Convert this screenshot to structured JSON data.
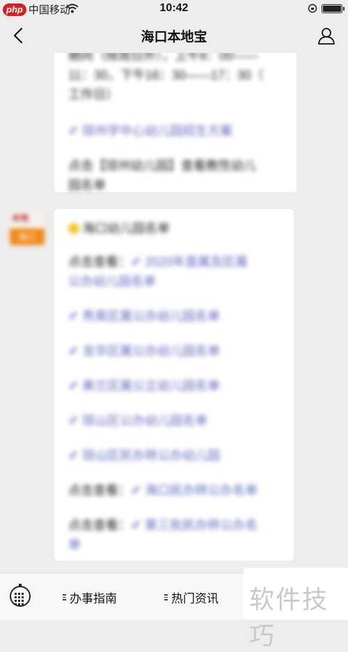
{
  "status_bar": {
    "badge": "php",
    "carrier": "中国移动",
    "time": "10:42"
  },
  "nav": {
    "title": "海口本地宝"
  },
  "message1": {
    "line1": "期间（除周日外），上午8：00——",
    "line2": "11：30，下午16：30——17：30（",
    "line3": "工作日）",
    "link": "✐ 琼州学中心幼儿园招生方案",
    "bottom_l1": "点击【琼州幼儿园】查看教性幼儿",
    "bottom_l2": "园名单"
  },
  "sender": {
    "avatar_top": "本地",
    "avatar_bottom": "海口"
  },
  "message2": {
    "heading": "海口幼儿园名单",
    "prefix1": "点击查看：",
    "link1_l1": "✐ 2020年直属及区属",
    "link1_l2": "公办幼儿园名单",
    "links": [
      "✐ 秀英区属公办幼儿园名单",
      "✐ 龙华区属公办幼儿园名单",
      "✐ 美兰区属公立幼儿园名单",
      "✐ 琼山区公办幼儿园名单",
      "✐ 琼山区民办转公办幼儿园"
    ],
    "prefix2": "点击查看：",
    "link2": "✐ 海口民办转公办名单",
    "prefix3": "点击查看：",
    "link3_l1": "✐ 第三批民办转公办名",
    "link3_l2": "单"
  },
  "toolbar": {
    "menu1": "办事指南",
    "menu2": "热门资讯"
  },
  "watermark": "软件技巧"
}
